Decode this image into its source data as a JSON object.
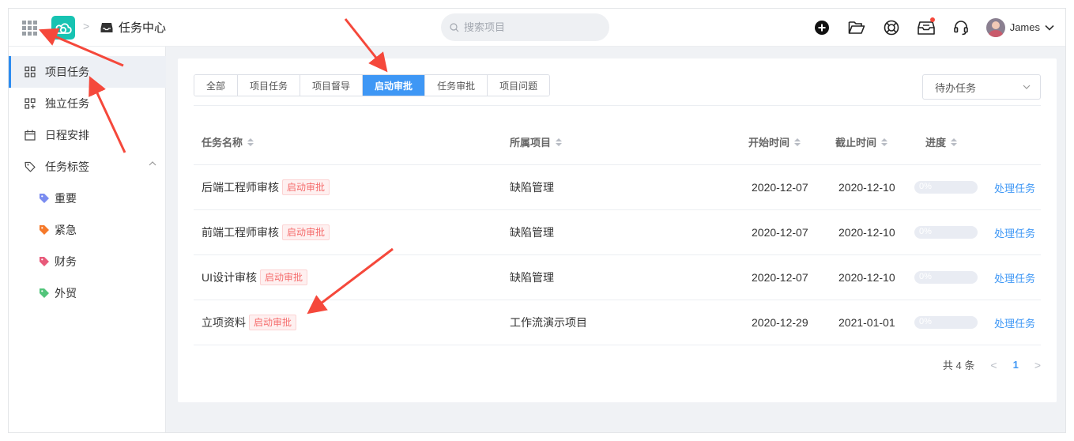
{
  "header": {
    "breadcrumb_title": "任务中心",
    "search_placeholder": "搜索项目",
    "user_name": "James"
  },
  "sidebar": {
    "items": [
      {
        "label": "项目任务",
        "active": true
      },
      {
        "label": "独立任务"
      },
      {
        "label": "日程安排"
      },
      {
        "label": "任务标签"
      }
    ],
    "tags": [
      {
        "label": "重要",
        "color": "#7a8cf0"
      },
      {
        "label": "紧急",
        "color": "#f5792a"
      },
      {
        "label": "财务",
        "color": "#e85a7a"
      },
      {
        "label": "外贸",
        "color": "#52c47a"
      }
    ]
  },
  "tabs": [
    "全部",
    "项目任务",
    "项目督导",
    "启动审批",
    "任务审批",
    "项目问题"
  ],
  "active_tab": "启动审批",
  "filter": {
    "selected": "待办任务"
  },
  "table": {
    "columns": [
      "任务名称",
      "所属项目",
      "开始时间",
      "截止时间",
      "进度"
    ],
    "rows": [
      {
        "name": "后端工程师审核",
        "badge": "启动审批",
        "project": "缺陷管理",
        "start": "2020-12-07",
        "end": "2020-12-10",
        "progress_text": "0%",
        "progress": 0,
        "action": "处理任务"
      },
      {
        "name": "前端工程师审核",
        "badge": "启动审批",
        "project": "缺陷管理",
        "start": "2020-12-07",
        "end": "2020-12-10",
        "progress_text": "0%",
        "progress": 0,
        "action": "处理任务"
      },
      {
        "name": "UI设计审核",
        "badge": "启动审批",
        "project": "缺陷管理",
        "start": "2020-12-07",
        "end": "2020-12-10",
        "progress_text": "0%",
        "progress": 0,
        "action": "处理任务"
      },
      {
        "name": "立项资料",
        "badge": "启动审批",
        "project": "工作流演示项目",
        "start": "2020-12-29",
        "end": "2021-01-01",
        "progress_text": "0%",
        "progress": 0,
        "action": "处理任务"
      }
    ]
  },
  "pagination": {
    "total_text": "共 4 条",
    "current_page": "1"
  },
  "colors": {
    "accent": "#3e97f5",
    "badge_red": "#f56c6c",
    "annotation_arrow": "#f5483b",
    "logo": "#17c3b2"
  }
}
